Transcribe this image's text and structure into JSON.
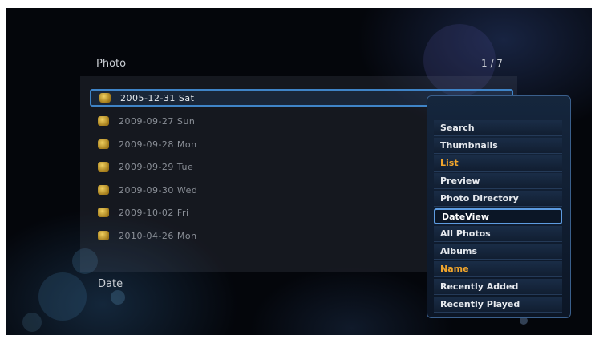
{
  "header": {
    "title": "Photo",
    "page_indicator": "1 / 7"
  },
  "list": {
    "items": [
      {
        "label": "2005-12-31 Sat"
      },
      {
        "label": "2009-09-27 Sun"
      },
      {
        "label": "2009-09-28 Mon"
      },
      {
        "label": "2009-09-29 Tue"
      },
      {
        "label": "2009-09-30 Wed"
      },
      {
        "label": "2009-10-02 Fri"
      },
      {
        "label": "2010-04-26 Mon"
      }
    ]
  },
  "footer": {
    "label": "Date"
  },
  "menu": {
    "items": [
      {
        "label": "Search"
      },
      {
        "label": "Thumbnails"
      },
      {
        "label": "List"
      },
      {
        "label": "Preview"
      },
      {
        "label": "Photo Directory"
      },
      {
        "label": "DateView"
      },
      {
        "label": "All Photos"
      },
      {
        "label": "Albums"
      },
      {
        "label": "Name"
      },
      {
        "label": "Recently Added"
      },
      {
        "label": "Recently Played"
      }
    ]
  },
  "colors": {
    "accent": "#3f84c7",
    "highlight": "#f1a52c",
    "background": "#04060b"
  },
  "icons": {
    "folder": "folder-icon"
  }
}
